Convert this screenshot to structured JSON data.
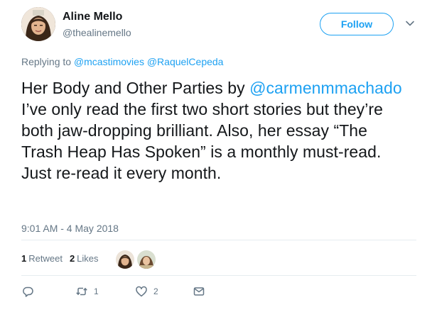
{
  "author": {
    "name": "Aline Mello",
    "handle": "@thealinemello"
  },
  "follow_button": {
    "label": "Follow"
  },
  "reply": {
    "prefix": "Replying to",
    "mentions": [
      "@mcastimovies",
      "@RaquelCepeda"
    ]
  },
  "tweet": {
    "text_before": "Her Body and Other Parties by ",
    "mention": "@carmenmmachado",
    "text_after": " I’ve only read the first two short stories but they’re both jaw-dropping brilliant. Also, her essay “The Trash Heap Has Spoken” is a monthly must-read. Just re-read it every month.",
    "timestamp": "9:01 AM - 4 May 2018"
  },
  "stats": {
    "retweets_count": "1",
    "retweets_label": "Retweet",
    "likes_count": "2",
    "likes_label": "Likes"
  },
  "actions": {
    "reply_icon": "reply-icon",
    "retweet_icon": "retweet-icon",
    "retweet_count": "1",
    "like_icon": "heart-icon",
    "like_count": "2",
    "dm_icon": "envelope-icon"
  },
  "colors": {
    "accent": "#1da1f2",
    "secondary_text": "#657786",
    "primary_text": "#14171a",
    "divider": "#e6ecf0"
  }
}
